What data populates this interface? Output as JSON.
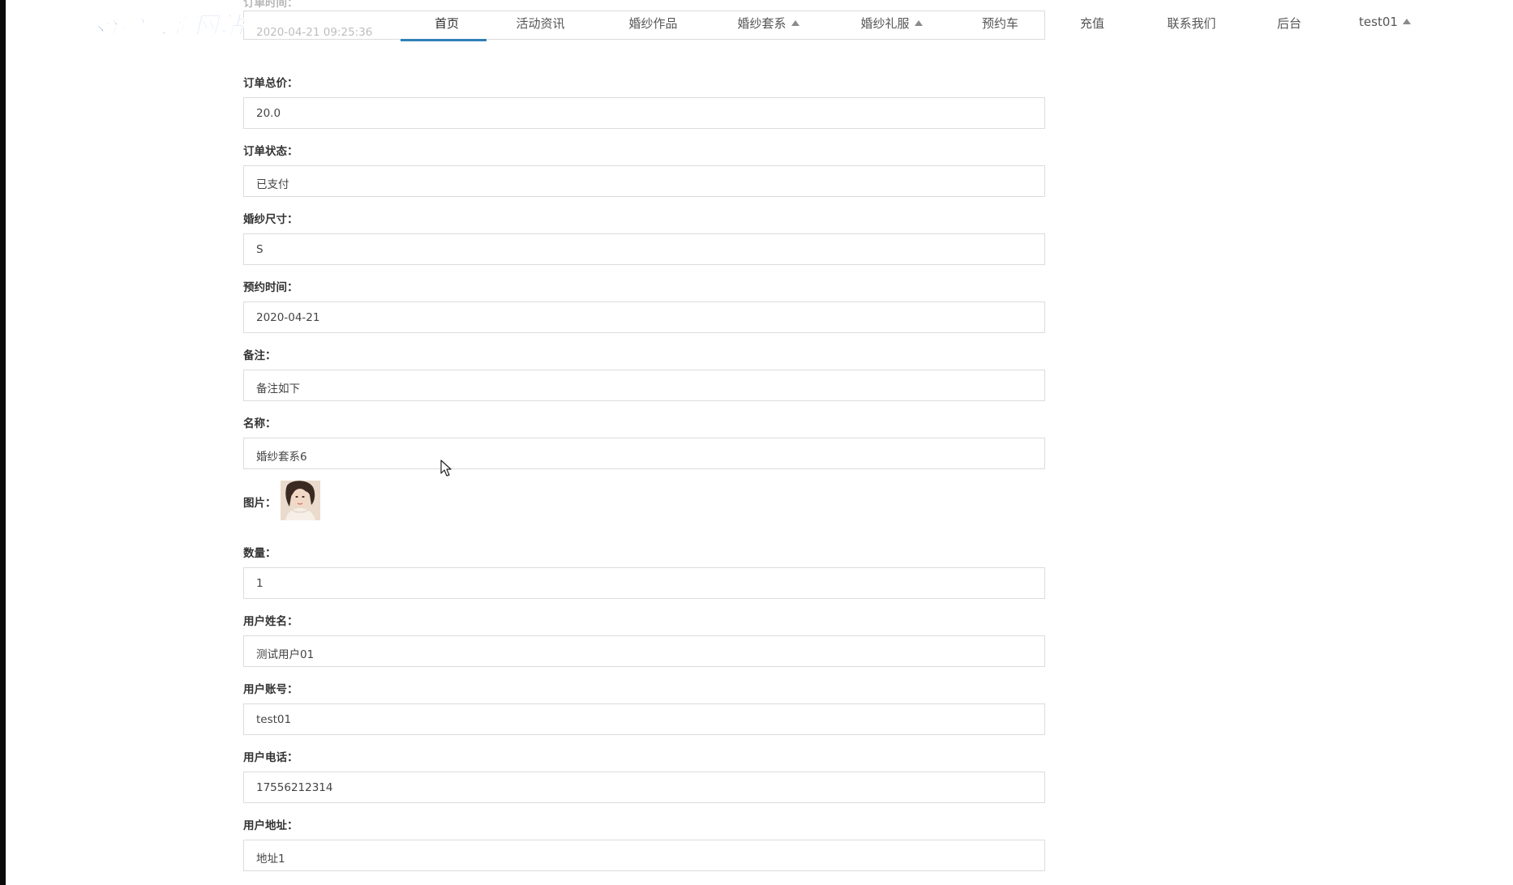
{
  "brand": {
    "logo_text": "婚纱摄影网站",
    "logo_color": "#3b72c6"
  },
  "nav": {
    "items": [
      {
        "label": "首页",
        "active": true
      },
      {
        "label": "活动资讯"
      },
      {
        "label": "婚纱作品"
      },
      {
        "label": "婚纱套系",
        "dropdown": true
      },
      {
        "label": "婚纱礼服",
        "dropdown": true
      },
      {
        "label": "预约车"
      },
      {
        "label": "充值"
      },
      {
        "label": "联系我们"
      },
      {
        "label": "后台"
      },
      {
        "label": "test01",
        "dropdown": true
      }
    ],
    "active_color": "#2f80b7"
  },
  "form": {
    "partial_top": {
      "label": "订单时间：",
      "value": "2020-04-21 09:25:36"
    },
    "total_price": {
      "label": "订单总价：",
      "value": "20.0"
    },
    "status": {
      "label": "订单状态：",
      "value": "已支付"
    },
    "size": {
      "label": "婚纱尺寸：",
      "value": "S"
    },
    "appointment": {
      "label": "预约时间：",
      "value": "2020-04-21"
    },
    "remark": {
      "label": "备注：",
      "value": "备注如下"
    },
    "name": {
      "label": "名称：",
      "value": "婚纱套系6"
    },
    "image": {
      "label": "图片："
    },
    "quantity": {
      "label": "数量：",
      "value": "1"
    },
    "user_name": {
      "label": "用户姓名：",
      "value": "测试用户01"
    },
    "user_account": {
      "label": "用户账号：",
      "value": "test01"
    },
    "user_phone": {
      "label": "用户电话：",
      "value": "17556212314"
    },
    "user_address": {
      "label": "用户地址：",
      "value": "地址1"
    }
  }
}
